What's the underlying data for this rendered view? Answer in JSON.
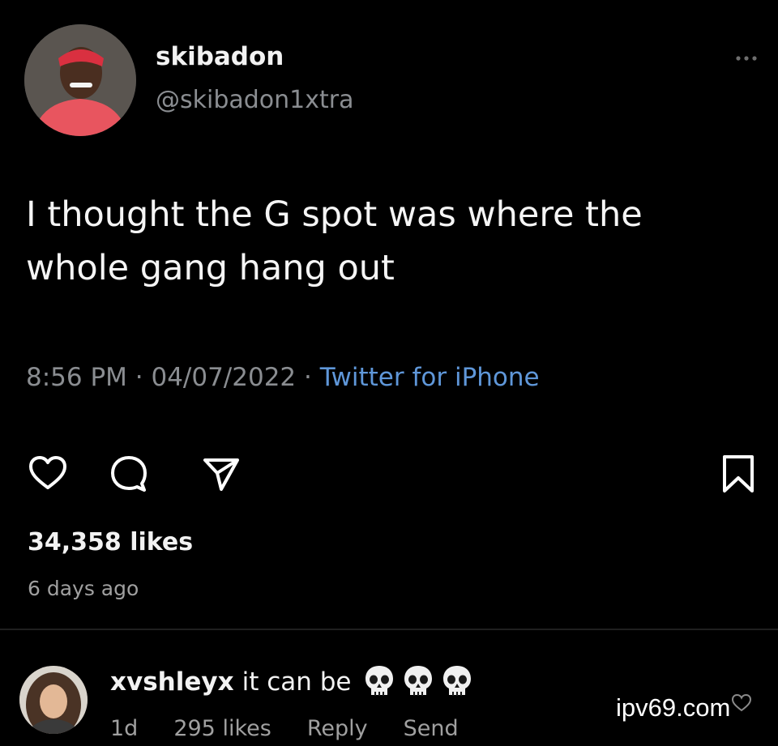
{
  "tweet": {
    "display_name": "skibadon",
    "handle": "@skibadon1xtra",
    "text": "I thought the G spot was where the whole gang hang out",
    "time": "8:56 PM · 04/07/2022 · ",
    "source": "Twitter for iPhone"
  },
  "post": {
    "likes": "34,358 likes",
    "age": "6 days ago"
  },
  "comment": {
    "username": "xvshleyx",
    "text": "it can be",
    "emoji": [
      "skull",
      "skull",
      "skull"
    ],
    "age": "1d",
    "likes": "295 likes",
    "reply_label": "Reply",
    "send_label": "Send"
  },
  "watermark": "ipv69.com",
  "icons": [
    "more-icon",
    "heart-icon",
    "comment-icon",
    "share-icon",
    "bookmark-icon",
    "skull-emoji"
  ],
  "colors": {
    "background": "#000000",
    "primary_text": "#f5f5f5",
    "secondary_text": "#8a8d91",
    "link": "#5f97d9"
  }
}
